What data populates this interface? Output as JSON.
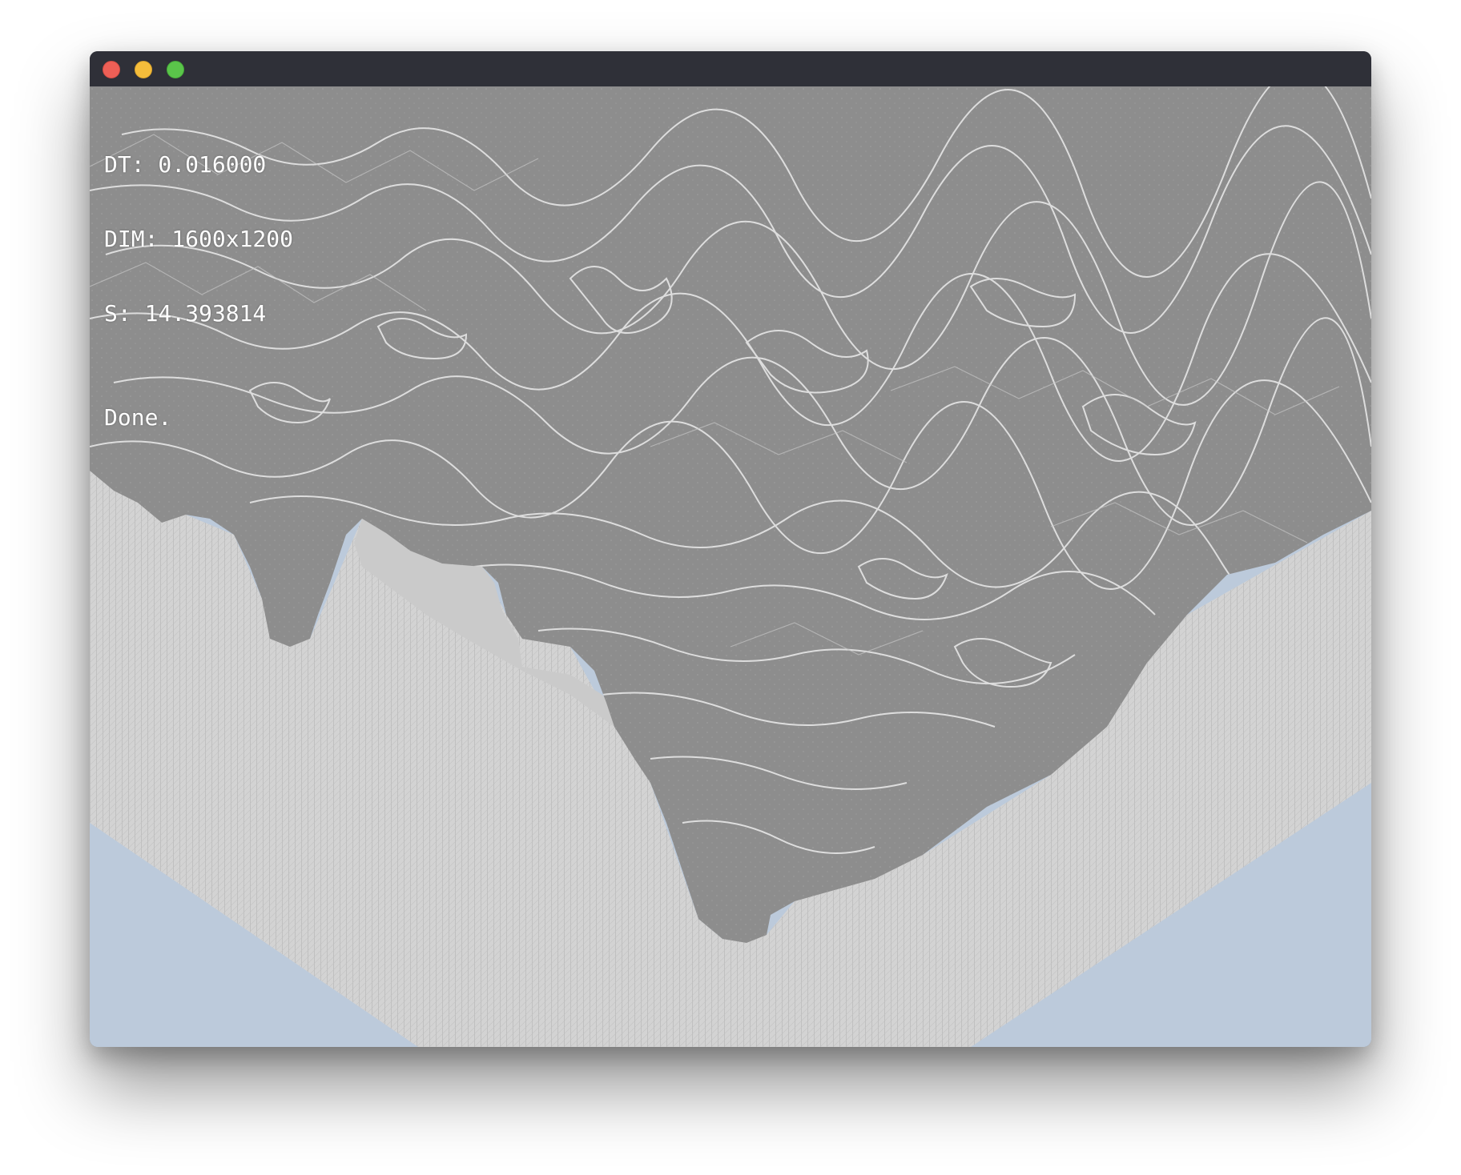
{
  "window": {
    "close_color": "#ed5f56",
    "minimize_color": "#f5bd3b",
    "maximize_color": "#5ac54a"
  },
  "hud": {
    "dt_label": "DT: 0.016000",
    "dim_label": "DIM: 1600x1200",
    "s_label": "S: 14.393814"
  },
  "status": {
    "text": "Done."
  },
  "colors": {
    "background": "#bccadb",
    "terrain_top": "#8c8c8c",
    "terrain_contour": "#e8e8e8",
    "cliff_wall": "#d2d2d2",
    "cliff_lines": "#a9a9a9",
    "flat_ledge": "#cbcbcb"
  }
}
